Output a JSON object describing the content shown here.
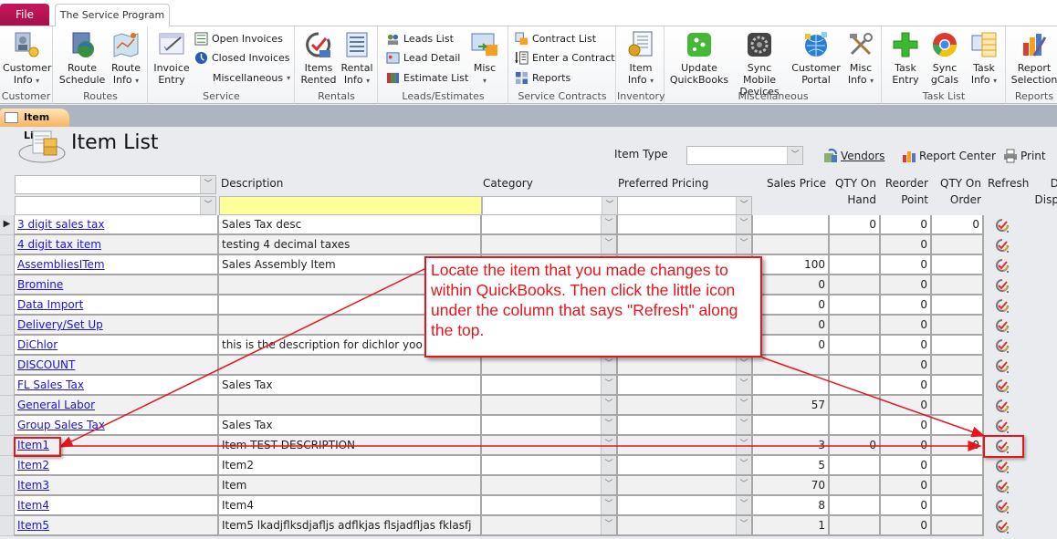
{
  "ribbon": {
    "file_tab": "File",
    "program_tab": "The Service Program",
    "groups": {
      "customer": {
        "label": "Customer",
        "customer_info": "Customer",
        "customer_info2": "Info"
      },
      "routes": {
        "label": "Routes",
        "route_schedule": "Route",
        "route_schedule2": "Schedule",
        "route_info": "Route",
        "route_info2": "Info"
      },
      "service": {
        "label": "Service",
        "invoice_entry": "Invoice",
        "invoice_entry2": "Entry",
        "open_invoices": "Open Invoices",
        "closed_invoices": "Closed Invoices",
        "miscellaneous": "Miscellaneous"
      },
      "rentals": {
        "label": "Rentals",
        "items_rented": "Items",
        "items_rented2": "Rented",
        "rental_info": "Rental",
        "rental_info2": "Info"
      },
      "leads": {
        "label": "Leads/Estimates",
        "leads_list": "Leads List",
        "lead_detail": "Lead Detail",
        "estimate_list": "Estimate List",
        "misc": "Misc"
      },
      "contracts": {
        "label": "Service Contracts",
        "contract_list": "Contract List",
        "enter_contract": "Enter a Contract",
        "reports": "Reports"
      },
      "inventory": {
        "label": "Inventory",
        "item_info": "Item",
        "item_info2": "Info"
      },
      "misc": {
        "label": "Miscellaneous",
        "update_qb": "Update",
        "update_qb2": "QuickBooks",
        "sync_mobile": "Sync Mobile",
        "sync_mobile2": "Devices",
        "customer_portal": "Customer",
        "customer_portal2": "Portal",
        "misc_info": "Misc",
        "misc_info2": "Info"
      },
      "tasks": {
        "label": "Task List",
        "task_entry": "Task",
        "task_entry2": "Entry",
        "sync_gcals": "Sync",
        "sync_gcals2": "gCals",
        "task_info": "Task",
        "task_info2": "Info"
      },
      "reports": {
        "label": "Reports",
        "report_selection": "Report",
        "report_selection2": "Selection"
      }
    }
  },
  "doc_tab": "Item List",
  "form": {
    "title": "Item List",
    "item_type_label": "Item Type",
    "item_type_value": "",
    "vendors": "Vendors",
    "report_center": "Report Center",
    "print": "Print"
  },
  "columns": {
    "description": "Description",
    "category": "Category",
    "preferred_pricing": "Preferred Pricing",
    "sales_price": "Sales Price",
    "qty_on_hand_1": "QTY On",
    "qty_on_hand_2": "Hand",
    "reorder_1": "Reorder",
    "reorder_2": "Point",
    "qty_on_order_1": "QTY On",
    "qty_on_order_2": "Order",
    "refresh": "Refresh",
    "disp_1": "D",
    "disp_2": "Disp"
  },
  "rows": [
    {
      "name": "3 digit sales tax",
      "description": "Sales Tax desc",
      "sales_price": "",
      "qty_on_hand": "0",
      "reorder": "0",
      "qty_on_order": "0"
    },
    {
      "name": "4 digit tax item",
      "description": "testing 4 decimal taxes",
      "sales_price": "",
      "qty_on_hand": "",
      "reorder": "0",
      "qty_on_order": ""
    },
    {
      "name": "AssembliesITem",
      "description": "Sales Assembly Item",
      "sales_price": "100",
      "qty_on_hand": "",
      "reorder": "0",
      "qty_on_order": ""
    },
    {
      "name": "Bromine",
      "description": "",
      "sales_price": "0",
      "qty_on_hand": "",
      "reorder": "0",
      "qty_on_order": ""
    },
    {
      "name": "Data Import",
      "description": "",
      "sales_price": "0",
      "qty_on_hand": "",
      "reorder": "0",
      "qty_on_order": ""
    },
    {
      "name": "Delivery/Set Up",
      "description": "",
      "sales_price": "0",
      "qty_on_hand": "",
      "reorder": "0",
      "qty_on_order": ""
    },
    {
      "name": "DiChlor",
      "description": "this is the description for dichlor yoo",
      "sales_price": "0",
      "qty_on_hand": "",
      "reorder": "0",
      "qty_on_order": ""
    },
    {
      "name": "DISCOUNT",
      "description": "",
      "sales_price": "",
      "qty_on_hand": "",
      "reorder": "0",
      "qty_on_order": ""
    },
    {
      "name": "FL Sales Tax",
      "description": "Sales Tax",
      "sales_price": "",
      "qty_on_hand": "",
      "reorder": "0",
      "qty_on_order": ""
    },
    {
      "name": "General Labor",
      "description": "",
      "sales_price": "57",
      "qty_on_hand": "",
      "reorder": "0",
      "qty_on_order": ""
    },
    {
      "name": "Group Sales Tax",
      "description": "Sales Tax",
      "sales_price": "",
      "qty_on_hand": "",
      "reorder": "0",
      "qty_on_order": ""
    },
    {
      "name": "Item1",
      "description": "Item TEST DESCRIPTION",
      "sales_price": "3",
      "qty_on_hand": "0",
      "reorder": "0",
      "qty_on_order": "0"
    },
    {
      "name": "Item2",
      "description": "Item2",
      "sales_price": "5",
      "qty_on_hand": "",
      "reorder": "0",
      "qty_on_order": ""
    },
    {
      "name": "Item3",
      "description": "Item",
      "sales_price": "70",
      "qty_on_hand": "",
      "reorder": "0",
      "qty_on_order": ""
    },
    {
      "name": "Item4",
      "description": "Item4",
      "sales_price": "8",
      "qty_on_hand": "",
      "reorder": "0",
      "qty_on_order": ""
    },
    {
      "name": "Item5",
      "description": "Item5 lkadjflksdjafljs adflkjas flsjadfljas fklasfj",
      "sales_price": "1",
      "qty_on_hand": "",
      "reorder": "0",
      "qty_on_order": ""
    }
  ],
  "annotation": {
    "text": "Locate the item that you made changes to within QuickBooks.  Then click the little icon under the column that says \"Refresh\" along the top.",
    "color": "#e8141b"
  },
  "icons": {
    "refresh": "refresh-check-icon",
    "dropdown": "chevron-down-icon",
    "record_pointer": "record-pointer-icon"
  }
}
